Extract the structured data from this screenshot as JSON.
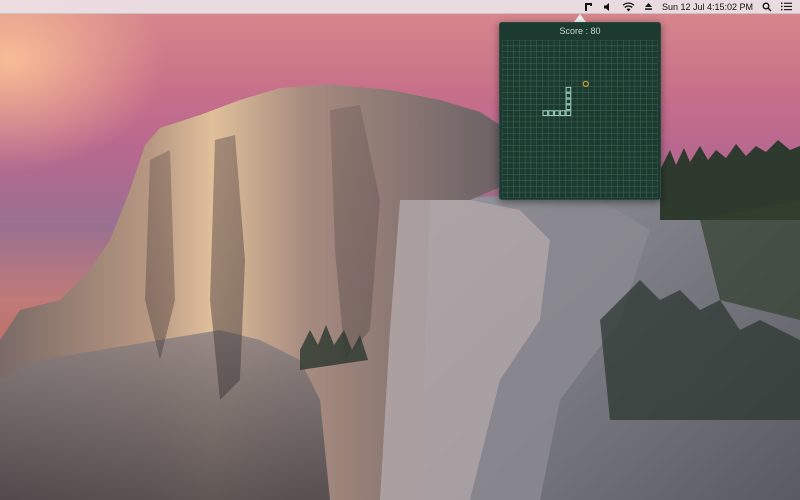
{
  "menubar": {
    "icons": [
      "snake-game-icon",
      "volume-icon",
      "wifi-icon",
      "eject-icon",
      "search-icon",
      "list-icon"
    ],
    "datetime": "Sun 12 Jul  4:15:02 PM"
  },
  "game": {
    "score_label": "Score : ",
    "score_value": "80",
    "grid": {
      "cols": 27,
      "rows": 27
    },
    "snake": [
      [
        11,
        8
      ],
      [
        11,
        9
      ],
      [
        11,
        10
      ],
      [
        11,
        11
      ],
      [
        11,
        12
      ],
      [
        10,
        12
      ],
      [
        9,
        12
      ],
      [
        8,
        12
      ],
      [
        7,
        12
      ]
    ],
    "food": [
      14,
      7
    ],
    "colors": {
      "background": "#1d3a30",
      "grid_line": "#3e6a58",
      "snake": "#9fd0c0",
      "food": "#c9a23a"
    }
  },
  "colors": {
    "menubar_bg": "#ece2e8"
  }
}
